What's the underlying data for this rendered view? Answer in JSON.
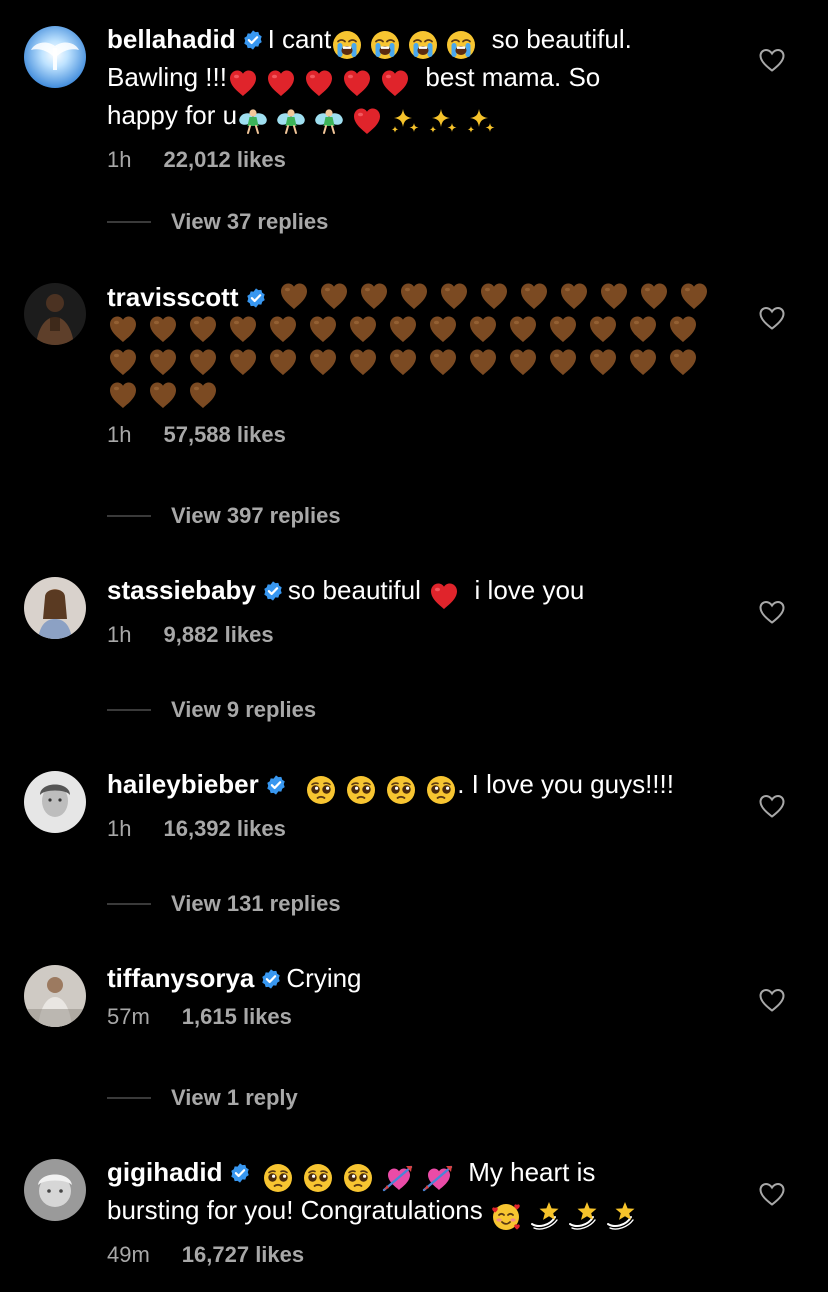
{
  "colors": {
    "background": "#000000",
    "text": "#ffffff",
    "muted": "#a8a8a8",
    "verified": "#3897f0",
    "red_heart": "#e0242b",
    "brown_heart": "#7b4a22"
  },
  "comments": [
    {
      "username": "bellahadid",
      "text_parts": [
        "I cant",
        "so beautiful.",
        "Bawling !!!",
        "best mama. So",
        "happy for u"
      ],
      "emoji": [
        "loudly-crying-face",
        "red-heart",
        "fairy",
        "sparkles"
      ],
      "time": "1h",
      "likes": "22,012 likes",
      "replies": "View 37 replies"
    },
    {
      "username": "travisscott",
      "emoji": [
        "brown-heart"
      ],
      "brown_heart_count": 44,
      "time": "1h",
      "likes": "57,588 likes",
      "replies": "View 397 replies"
    },
    {
      "username": "stassiebaby",
      "text_parts": [
        "so beautiful",
        "i love you"
      ],
      "emoji": [
        "red-heart"
      ],
      "time": "1h",
      "likes": "9,882 likes",
      "replies": "View 9 replies"
    },
    {
      "username": "haileybieber",
      "text_parts": [
        ". I love you guys!!!!"
      ],
      "emoji": [
        "pleading-face"
      ],
      "time": "1h",
      "likes": "16,392 likes",
      "replies": "View 131 replies"
    },
    {
      "username": "tiffanysorya",
      "text_parts": [
        "Crying"
      ],
      "time": "57m",
      "likes": "1,615 likes",
      "replies": "View 1 reply"
    },
    {
      "username": "gigihadid",
      "text_parts": [
        "My heart is",
        "bursting for you! Congratulations"
      ],
      "emoji": [
        "pleading-face",
        "heart-with-arrow",
        "smiling-face-with-hearts",
        "dizzy"
      ],
      "time": "49m",
      "likes": "16,727 likes"
    }
  ]
}
